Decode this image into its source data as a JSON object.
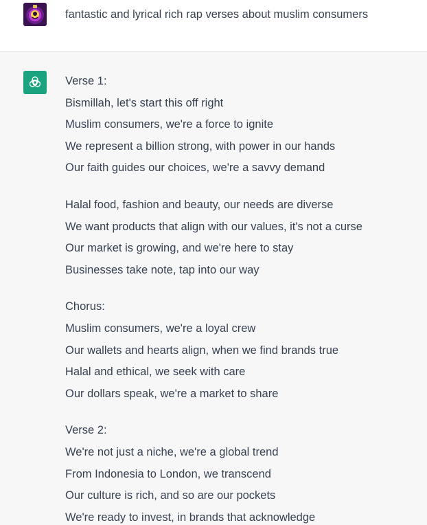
{
  "user": {
    "avatar_icon": "user-avatar-icon",
    "message": "fantastic and lyrical rich rap verses about muslim consumers"
  },
  "assistant": {
    "avatar_icon": "openai-logo-icon",
    "accent_color": "#19a37f",
    "stanzas": [
      {
        "lines": [
          "Verse 1:",
          "Bismillah, let's start this off right",
          "Muslim consumers, we're a force to ignite",
          "We represent a billion strong, with power in our hands",
          "Our faith guides our choices, we're a savvy demand"
        ]
      },
      {
        "lines": [
          "Halal food, fashion and beauty, our needs are diverse",
          "We want products that align with our values, it's not a curse",
          "Our market is growing, and we're here to stay",
          "Businesses take note, tap into our way"
        ]
      },
      {
        "lines": [
          "Chorus:",
          "Muslim consumers, we're a loyal crew",
          "Our wallets and hearts align, when we find brands true",
          "Halal and ethical, we seek with care",
          "Our dollars speak, we're a market to share"
        ]
      },
      {
        "lines": [
          "Verse 2:",
          "We're not just a niche, we're a global trend",
          "From Indonesia to London, we transcend",
          "Our culture is rich, and so are our pockets",
          "We're ready to invest, in brands that acknowledge"
        ]
      }
    ]
  }
}
